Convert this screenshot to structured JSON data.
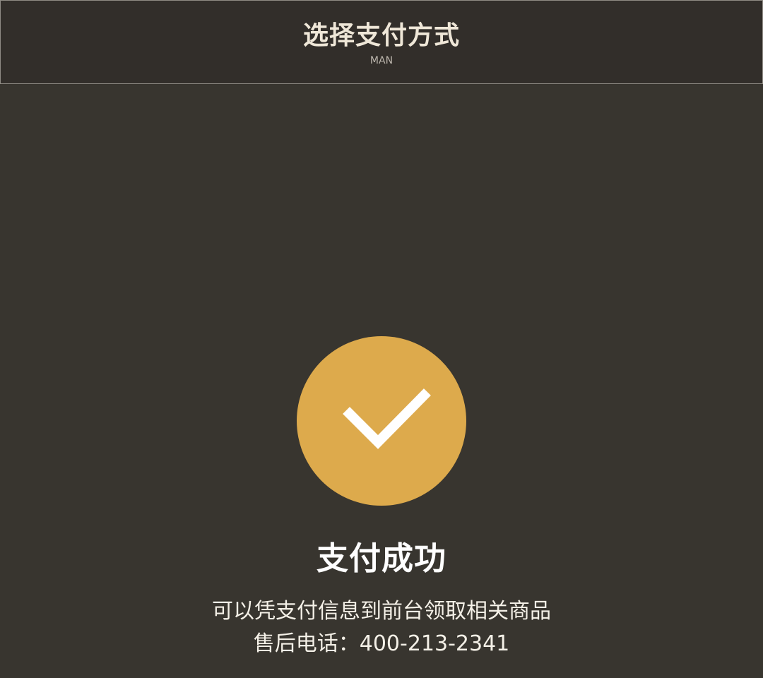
{
  "header": {
    "title": "选择支付方式",
    "subtitle": "MAN"
  },
  "status": {
    "icon": "checkmark-icon",
    "icon_color": "#ddaa4c",
    "title": "支付成功",
    "message": "可以凭支付信息到前台领取相关商品",
    "hotline_label": "售后电话：",
    "hotline_number": "400-213-2341"
  },
  "colors": {
    "background": "#38352f",
    "header_background": "#322e2a",
    "accent": "#ddaa4c"
  }
}
